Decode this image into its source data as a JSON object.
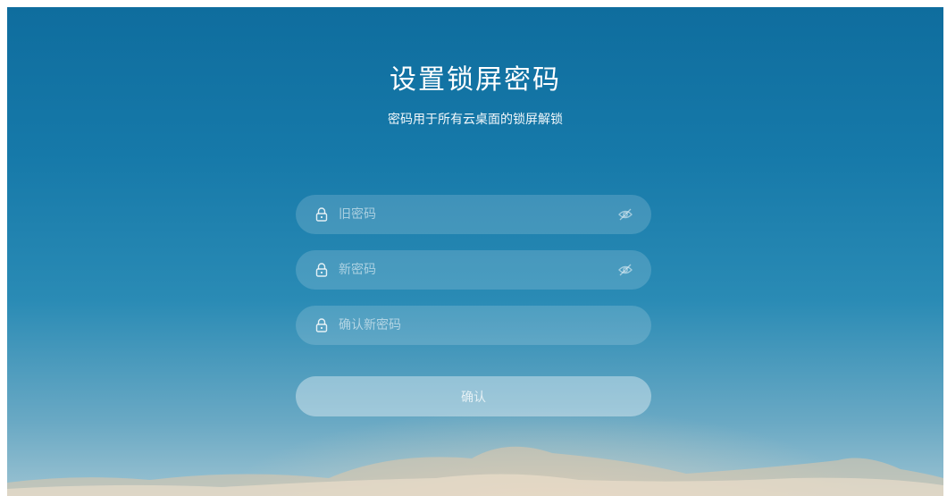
{
  "header": {
    "title": "设置锁屏密码",
    "subtitle": "密码用于所有云桌面的锁屏解锁"
  },
  "form": {
    "old_password": {
      "placeholder": "旧密码",
      "value": ""
    },
    "new_password": {
      "placeholder": "新密码",
      "value": ""
    },
    "confirm_password": {
      "placeholder": "确认新密码",
      "value": ""
    },
    "confirm_label": "确认"
  },
  "icons": {
    "lock": "lock-icon",
    "toggle_visibility": "eye-off-icon"
  },
  "colors": {
    "sky_top": "#0f6d9e",
    "sky_bottom": "#9cc3d2",
    "text": "#ffffff"
  }
}
